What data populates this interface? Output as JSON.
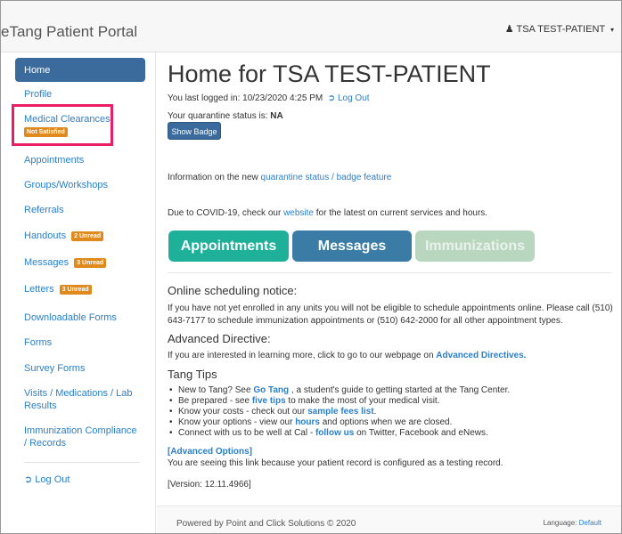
{
  "header": {
    "brand": "eTang Patient Portal",
    "user_icon": "user-icon",
    "user_name": "TSA TEST-PATIENT",
    "caret": "▾"
  },
  "sidebar": {
    "items": [
      {
        "label": "Home"
      },
      {
        "label": "Profile"
      },
      {
        "label": "Medical Clearances",
        "badge": "Not Satisfied"
      },
      {
        "label": "Appointments"
      },
      {
        "label": "Groups/Workshops"
      },
      {
        "label": "Referrals"
      },
      {
        "label": "Handouts",
        "badge": "2 Unread"
      },
      {
        "label": "Messages",
        "badge": "3 Unread"
      },
      {
        "label": "Letters",
        "badge": "3 Unread"
      },
      {
        "label": "Downloadable Forms"
      },
      {
        "label": "Forms"
      },
      {
        "label": "Survey Forms"
      },
      {
        "label": "Visits / Medications / Lab Results"
      },
      {
        "label": "Immunization Compliance / Records"
      },
      {
        "label": "Log Out",
        "icon": "logout-icon"
      }
    ]
  },
  "main": {
    "title": "Home for TSA TEST-PATIENT",
    "last_login_prefix": "You last logged in: 10/23/2020 4:25 PM",
    "logout_link": "Log Out",
    "quarantine_prefix": "Your quarantine status is:",
    "quarantine_value": "NA",
    "show_badge": "Show Badge",
    "info_prefix": "Information on the new",
    "info_link": "quarantine status / badge feature",
    "covid_prefix": "Due to COVID-19, check our",
    "covid_link": "website",
    "covid_suffix": "for the latest on current services and hours.",
    "buttons": {
      "appointments": "Appointments",
      "messages": "Messages",
      "immunizations": "Immunizations"
    },
    "online_heading": "Online scheduling notice:",
    "online_text": "If you have not yet enrolled in any units you will not be eligible to schedule appointments online. Please call (510) 643-7177 to schedule immunization appointments or (510) 642-2000 for all other appointment types.",
    "advdir_heading": "Advanced Directive:",
    "advdir_prefix": "If you are interested in learning more, click to go to our webpage on",
    "advdir_link": "Advanced Directives.",
    "tips_heading": "Tang Tips",
    "tips": [
      {
        "pre": "New to Tang? See",
        "link": "Go Tang",
        "post": ", a student's guide to getting started at the Tang Center."
      },
      {
        "pre": "Be prepared - see",
        "link": "five tips",
        "post": "to make the most of your medical visit."
      },
      {
        "pre": "Know your costs - check out our",
        "link": "sample fees list",
        "post": "."
      },
      {
        "pre": "Know your options - view our",
        "link": "hours",
        "post": "and options when we are closed."
      },
      {
        "pre": "Connect with us to be well at Cal -",
        "link": "follow us",
        "post": "on Twitter, Facebook and eNews."
      }
    ],
    "advanced_options": "[Advanced Options]",
    "testing_note": "You are seeing this link because your patient record is configured as a testing record.",
    "version": "[Version: 12.11.4966]"
  },
  "footer": {
    "powered": "Powered by Point and Click Solutions © 2020",
    "language_label": "Language:",
    "language_value": "Default"
  }
}
